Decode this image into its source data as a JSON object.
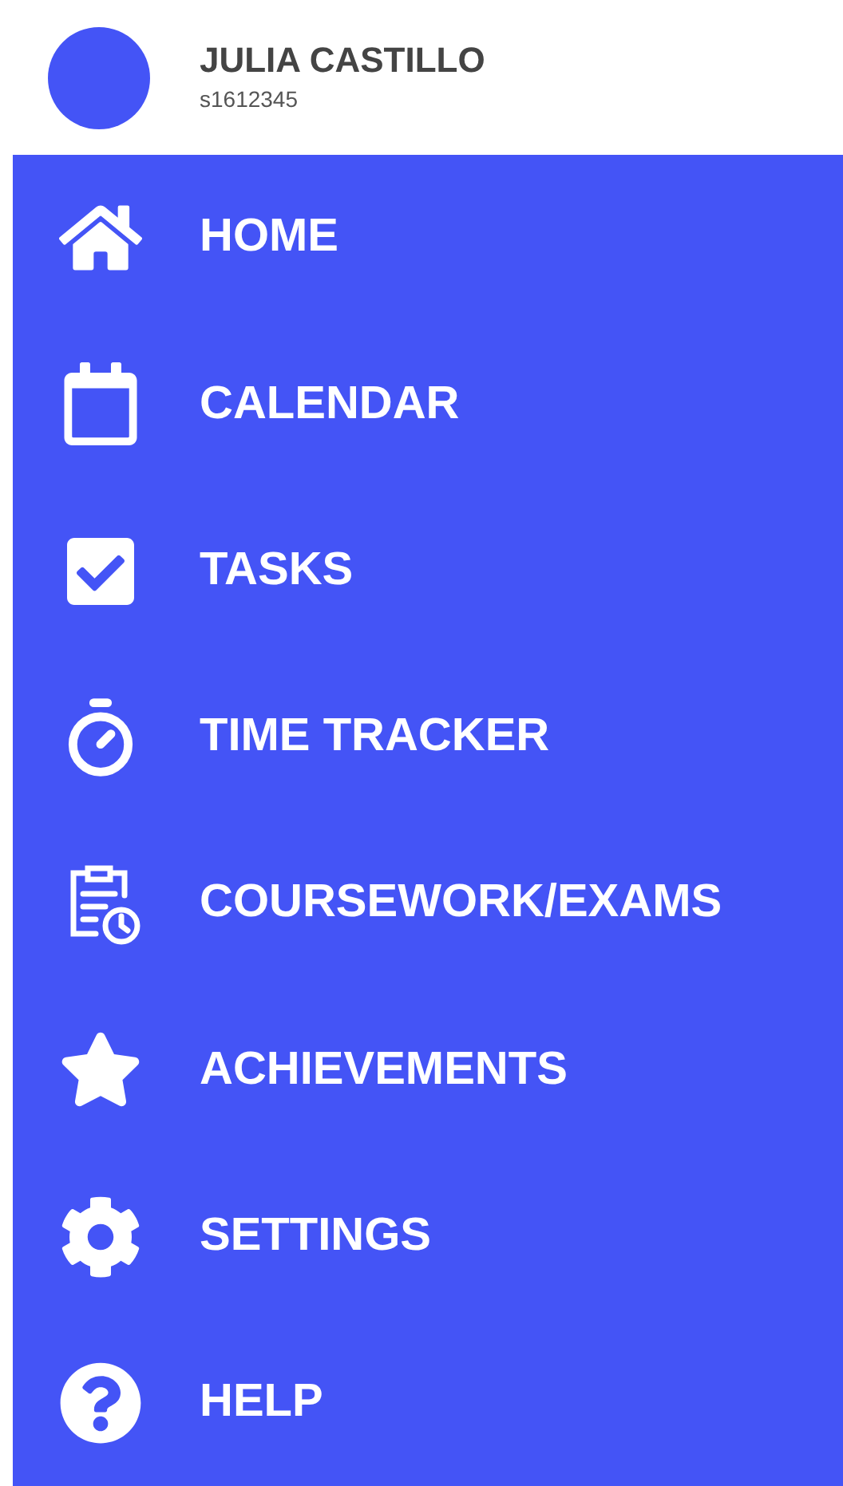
{
  "profile": {
    "name": "JULIA CASTILLO",
    "id": "s1612345"
  },
  "menu": [
    {
      "kind": "home",
      "label": "HOME"
    },
    {
      "kind": "calendar",
      "label": "CALENDAR"
    },
    {
      "kind": "tasks",
      "label": "TASKS"
    },
    {
      "kind": "timer",
      "label": "TIME TRACKER"
    },
    {
      "kind": "coursework",
      "label": "COURSEWORK/EXAMS"
    },
    {
      "kind": "star",
      "label": "ACHIEVEMENTS"
    },
    {
      "kind": "settings",
      "label": "SETTINGS"
    },
    {
      "kind": "help",
      "label": "HELP"
    }
  ]
}
